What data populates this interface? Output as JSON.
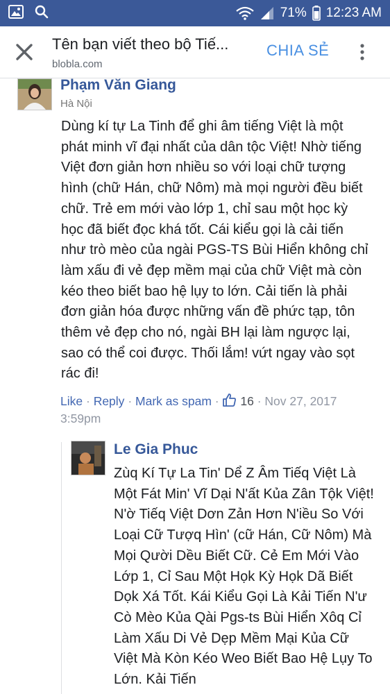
{
  "status_bar": {
    "battery": "71%",
    "time": "12:23 AM",
    "colors": {
      "background": "#3b5998"
    }
  },
  "header": {
    "title": "Tên bạn viết theo bộ Tiế...",
    "domain": "blobla.com",
    "share_label": "CHIA SẺ",
    "share_color": "#4a90e2"
  },
  "comment": {
    "author": "Phạm Văn Giang",
    "location": "Hà Nội",
    "text": "Dùng kí tự La Tinh để ghi âm tiếng Việt là một phát minh vĩ đại nhất của dân tộc Việt! Nhờ tiếng Việt đơn giản hơn nhiều so với loại chữ tượng hình (chữ Hán, chữ Nôm) mà mọi người đều biết chữ. Trẻ em mới vào lớp 1, chỉ sau một học kỳ học đã biết đọc khá tốt. Cái kiểu gọi là cải tiến như trò mèo của ngài PGS-TS Bùi Hiển không chỉ làm xấu đi vẻ đẹp mềm mại của chữ Việt mà còn kéo theo biết bao hệ lụy to lớn. Cải tiến là phải đơn giản hóa được những vấn đề phức tạp, tôn thêm vẻ đẹp cho nó, ngài BH lại làm ngược lại, sao có thể coi được. Thối lắm! vứt ngay vào sọt rác đi!",
    "actions": {
      "like": "Like",
      "reply": "Reply",
      "spam": "Mark as spam",
      "separator": "·",
      "like_count": "16",
      "date": "Nov 27, 2017",
      "time": "3:59pm"
    },
    "name_color": "#365899",
    "link_color": "#4267b2"
  },
  "reply": {
    "author": "Le Gia Phuc",
    "text": "Zùq Kí Tự La Tin' Dể Z Âm Tiếq Việt Là Một Fát Min' Vĩ Dại N'ất Kủa Zân Tộk Việt! N'ờ Tiếq Việt Dơn Zản Hơn N'iều So Với Loại Cữ Tượq Hìn' (cữ Hán, Cữ Nôm) Mà Mọi Qười Dều Biết Cữ. Cẻ Em Mới Vào Lớp 1, Cỉ Sau Một Họk Kỳ Họk Dã Biết Dọk Xá Tốt. Kái Kiểu Gọi Là Kải Tiến N'ư Cò Mèo Kủa Qài Pgs-ts Bùi Hiển Xôq Cỉ Làm Xấu Di Vẻ Dẹp Mềm Mại Kủa Cữ Việt Mà Kòn Kéo Weo Biết Bao Hệ Lụy To Lớn. Kải Tiến"
  }
}
